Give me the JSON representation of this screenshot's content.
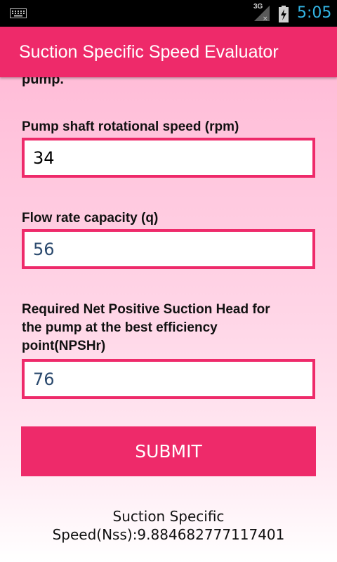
{
  "status_bar": {
    "network": "3G",
    "time": "5:05"
  },
  "app_bar": {
    "title": "Suction Specific Speed Evaluator"
  },
  "form": {
    "cut_off_text": "pump.",
    "fields": [
      {
        "label": "Pump shaft rotational speed (rpm)",
        "value": "34"
      },
      {
        "label": "Flow rate capacity (q)",
        "value": "56"
      },
      {
        "label_line1": "Required Net Positive Suction Head for",
        "label_line2": "the pump at the best efficiency",
        "label_line3": "point(NPSHr)",
        "value": "76"
      }
    ],
    "submit_label": "SUBMIT"
  },
  "result": {
    "line1": "Suction Specific",
    "line2": "Speed(Nss):9.884682777117401"
  },
  "colors": {
    "accent": "#ee2a6a",
    "status_text": "#33b5e5"
  }
}
